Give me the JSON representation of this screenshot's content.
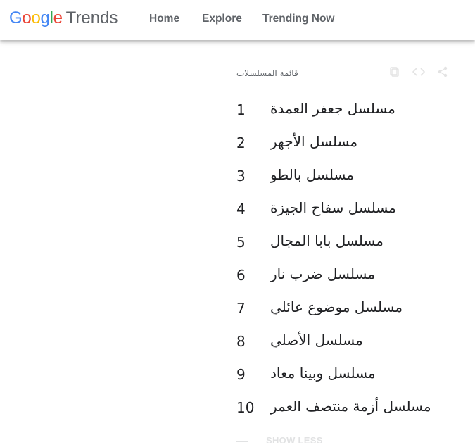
{
  "header": {
    "logo": {
      "google_letters": [
        {
          "char": "G",
          "color": "#4285F4"
        },
        {
          "char": "o",
          "color": "#EA4335"
        },
        {
          "char": "o",
          "color": "#FBBC05"
        },
        {
          "char": "g",
          "color": "#4285F4"
        },
        {
          "char": "l",
          "color": "#34A853"
        },
        {
          "char": "e",
          "color": "#EA4335"
        }
      ],
      "product": "Trends"
    },
    "nav": [
      {
        "label": "Home"
      },
      {
        "label": "Explore"
      },
      {
        "label": "Trending Now"
      }
    ]
  },
  "panel": {
    "title": "قائمة المسلسلات",
    "icons": [
      "copy-icon",
      "embed-icon",
      "share-icon"
    ],
    "accent_color": "#1a73e8"
  },
  "list": [
    {
      "rank": "1",
      "term": "مسلسل جعفر العمدة"
    },
    {
      "rank": "2",
      "term": "مسلسل الأجهر"
    },
    {
      "rank": "3",
      "term": "مسلسل بالطو"
    },
    {
      "rank": "4",
      "term": "مسلسل سفاح الجيزة"
    },
    {
      "rank": "5",
      "term": "مسلسل بابا المجال"
    },
    {
      "rank": "6",
      "term": "مسلسل ضرب نار"
    },
    {
      "rank": "7",
      "term": "مسلسل موضوع عائلي"
    },
    {
      "rank": "8",
      "term": "مسلسل الأصلي"
    },
    {
      "rank": "9",
      "term": "مسلسل وبينا معاد"
    },
    {
      "rank": "10",
      "term": "مسلسل أزمة منتصف العمر"
    }
  ],
  "footer": {
    "show_less": "SHOW LESS"
  }
}
